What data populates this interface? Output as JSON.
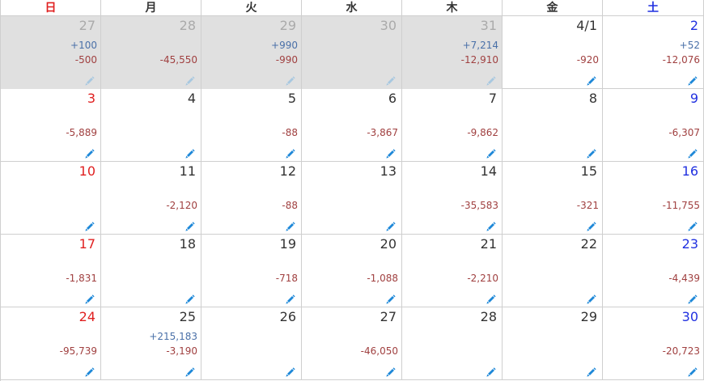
{
  "weekdays": [
    {
      "label": "日",
      "kind": "sun"
    },
    {
      "label": "月",
      "kind": "weekday"
    },
    {
      "label": "火",
      "kind": "weekday"
    },
    {
      "label": "水",
      "kind": "weekday"
    },
    {
      "label": "木",
      "kind": "weekday"
    },
    {
      "label": "金",
      "kind": "weekday"
    },
    {
      "label": "土",
      "kind": "sat"
    }
  ],
  "colors": {
    "sunday": "#e02020",
    "saturday": "#2030e0",
    "income": "#4a70a8",
    "expense": "#a04040",
    "edit_icon": "#1e88d8",
    "edit_icon_disabled": "#a8c8e0",
    "other_month_bg": "#e0e0e0"
  },
  "edit_icon": "pencil-icon",
  "weeks": [
    [
      {
        "day": "27",
        "income": "+100",
        "expense": "-500",
        "other": true
      },
      {
        "day": "28",
        "income": "",
        "expense": "-45,550",
        "other": true
      },
      {
        "day": "29",
        "income": "+990",
        "expense": "-990",
        "other": true
      },
      {
        "day": "30",
        "income": "",
        "expense": "",
        "other": true
      },
      {
        "day": "31",
        "income": "+7,214",
        "expense": "-12,910",
        "other": true
      },
      {
        "day": "4/1",
        "income": "",
        "expense": "-920",
        "other": false
      },
      {
        "day": "2",
        "income": "+52",
        "expense": "-12,076",
        "other": false
      }
    ],
    [
      {
        "day": "3",
        "income": "",
        "expense": "-5,889",
        "other": false
      },
      {
        "day": "4",
        "income": "",
        "expense": "",
        "other": false
      },
      {
        "day": "5",
        "income": "",
        "expense": "-88",
        "other": false
      },
      {
        "day": "6",
        "income": "",
        "expense": "-3,867",
        "other": false
      },
      {
        "day": "7",
        "income": "",
        "expense": "-9,862",
        "other": false
      },
      {
        "day": "8",
        "income": "",
        "expense": "",
        "other": false
      },
      {
        "day": "9",
        "income": "",
        "expense": "-6,307",
        "other": false
      }
    ],
    [
      {
        "day": "10",
        "income": "",
        "expense": "",
        "other": false
      },
      {
        "day": "11",
        "income": "",
        "expense": "-2,120",
        "other": false
      },
      {
        "day": "12",
        "income": "",
        "expense": "-88",
        "other": false
      },
      {
        "day": "13",
        "income": "",
        "expense": "",
        "other": false
      },
      {
        "day": "14",
        "income": "",
        "expense": "-35,583",
        "other": false
      },
      {
        "day": "15",
        "income": "",
        "expense": "-321",
        "other": false
      },
      {
        "day": "16",
        "income": "",
        "expense": "-11,755",
        "other": false
      }
    ],
    [
      {
        "day": "17",
        "income": "",
        "expense": "-1,831",
        "other": false
      },
      {
        "day": "18",
        "income": "",
        "expense": "",
        "other": false
      },
      {
        "day": "19",
        "income": "",
        "expense": "-718",
        "other": false
      },
      {
        "day": "20",
        "income": "",
        "expense": "-1,088",
        "other": false
      },
      {
        "day": "21",
        "income": "",
        "expense": "-2,210",
        "other": false
      },
      {
        "day": "22",
        "income": "",
        "expense": "",
        "other": false
      },
      {
        "day": "23",
        "income": "",
        "expense": "-4,439",
        "other": false
      }
    ],
    [
      {
        "day": "24",
        "income": "",
        "expense": "-95,739",
        "other": false
      },
      {
        "day": "25",
        "income": "+215,183",
        "expense": "-3,190",
        "other": false
      },
      {
        "day": "26",
        "income": "",
        "expense": "",
        "other": false
      },
      {
        "day": "27",
        "income": "",
        "expense": "-46,050",
        "other": false
      },
      {
        "day": "28",
        "income": "",
        "expense": "",
        "other": false
      },
      {
        "day": "29",
        "income": "",
        "expense": "",
        "other": false
      },
      {
        "day": "30",
        "income": "",
        "expense": "-20,723",
        "other": false
      }
    ]
  ]
}
